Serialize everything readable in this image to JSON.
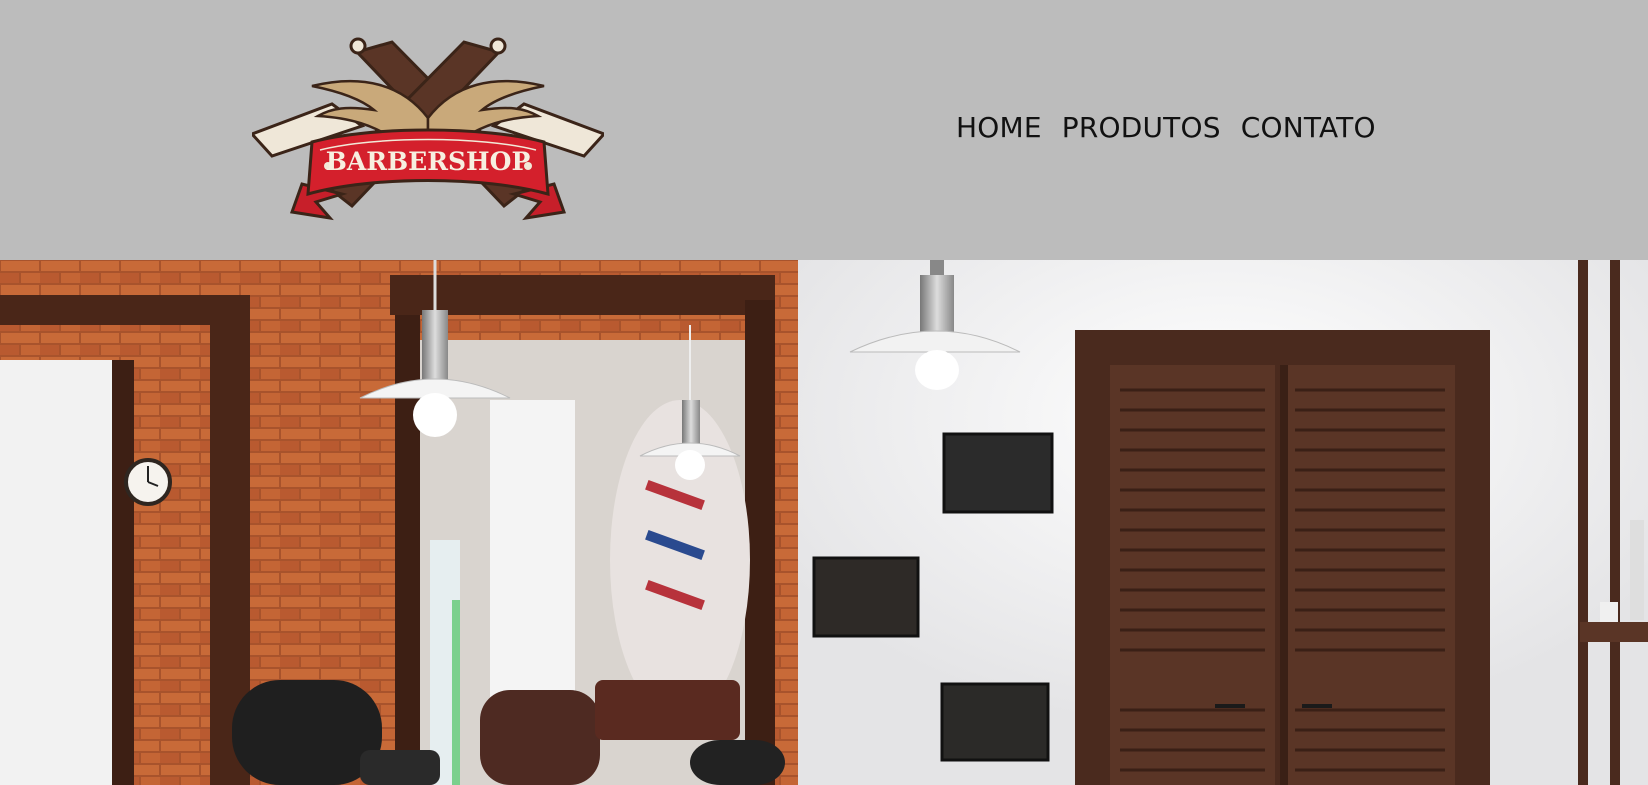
{
  "header": {
    "background": "#bcbcbc",
    "logo_text": "BARBERSHOP",
    "logo_icon": "crossed-razors-wings-icon"
  },
  "nav": {
    "items": [
      {
        "label": "HOME"
      },
      {
        "label": "PRODUTOS"
      },
      {
        "label": "CONTATO"
      }
    ]
  },
  "hero": {
    "image": "barbershop-interior-photo",
    "colors": {
      "brick": "#b5562e",
      "wood": "#4a2a1c",
      "wall": "#eeeeee"
    }
  }
}
